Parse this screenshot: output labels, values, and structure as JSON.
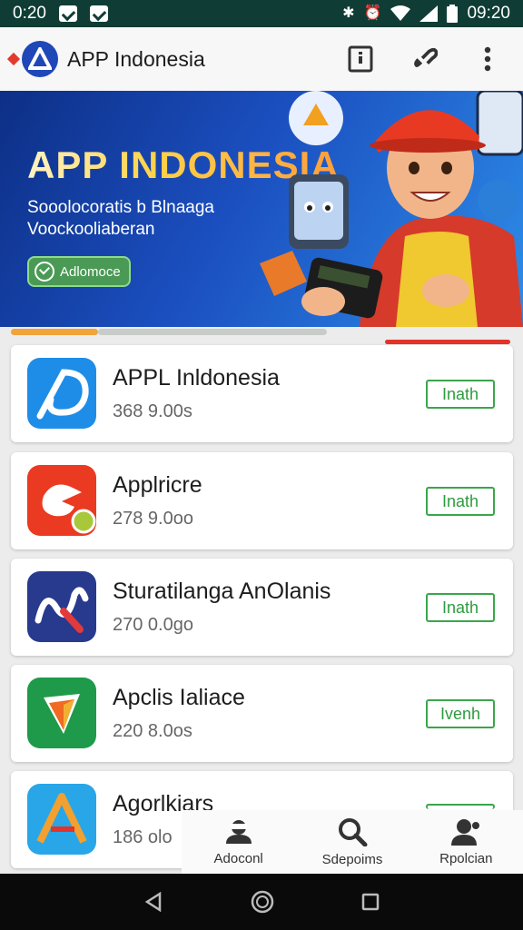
{
  "status_bar": {
    "time_left": "0:20",
    "time_right": "09:20"
  },
  "app_bar": {
    "title": "APP Indonesia",
    "icons": [
      "report-icon",
      "link-icon",
      "more-vert-icon"
    ]
  },
  "banner": {
    "title": "APP INDONESIA",
    "subtitle_line1": "Sooolocoratis b Blnaaga",
    "subtitle_line2": "Voockooliaberan",
    "button_label": "Adlomoce"
  },
  "apps": [
    {
      "name": "APPL Inldonesia",
      "meta": "368 9.00s",
      "button": "Inath",
      "icon": "app-indonesia-icon"
    },
    {
      "name": "Applricre",
      "meta": "278 9.0oo",
      "button": "Inath",
      "icon": "applricre-icon"
    },
    {
      "name": "Sturatilanga AnOlanis",
      "meta": "270 0.0go",
      "button": "Inath",
      "icon": "sturatilanga-icon"
    },
    {
      "name": "Apclis Ialiace",
      "meta": "220 8.0os",
      "button": "Ivenh",
      "icon": "apclis-icon"
    },
    {
      "name": "Agorlkiars",
      "meta": "186 olo",
      "button": "",
      "icon": "agorlkiars-icon"
    }
  ],
  "bottom_nav": [
    {
      "label": "Adoconl",
      "icon": "home-icon"
    },
    {
      "label": "Sdepoims",
      "icon": "search-icon"
    },
    {
      "label": "Rpolcian",
      "icon": "profile-icon"
    }
  ],
  "colors": {
    "status_bar": "#0f3d35",
    "install_green": "#3aa64a",
    "banner_blue": "#1b4fc0"
  }
}
